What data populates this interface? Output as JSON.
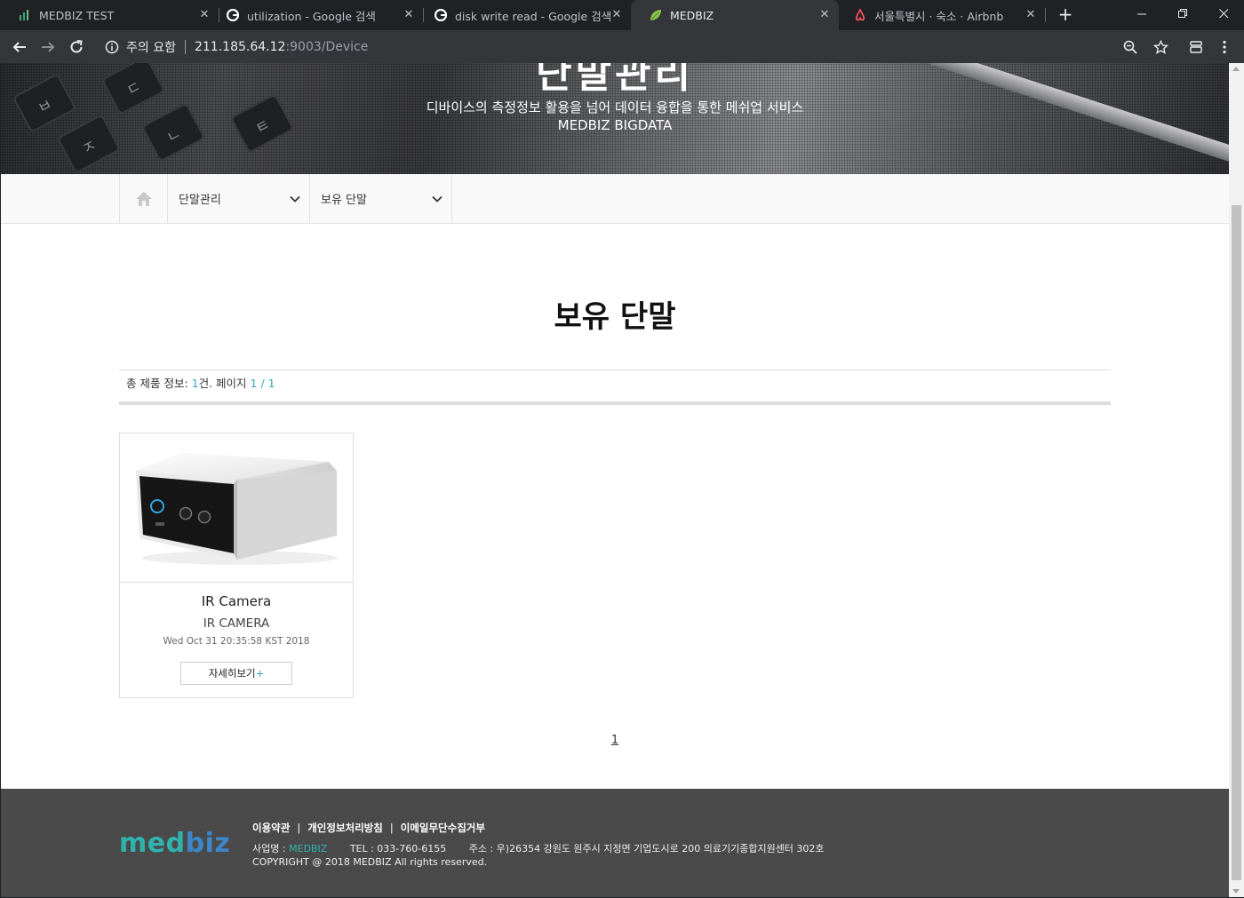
{
  "browser": {
    "tabs": [
      {
        "title": "MEDBIZ TEST",
        "favicon": "bar-chart-icon",
        "active": false
      },
      {
        "title": "utilization - Google 검색",
        "favicon": "google-icon",
        "active": false
      },
      {
        "title": "disk write read - Google 검색",
        "favicon": "google-icon",
        "active": false
      },
      {
        "title": "MEDBIZ",
        "favicon": "leaf-icon",
        "active": true
      },
      {
        "title": "서울특별시 · 숙소 · Airbnb",
        "favicon": "airbnb-icon",
        "active": false
      }
    ],
    "new_tab": "+",
    "security_warning": "주의 요함",
    "url_host": "211.185.64.12",
    "url_rest": ":9003/Device"
  },
  "hero": {
    "title": "단말관리",
    "subtitle": "디바이스의 측정정보 활용을 넘어 데이터 융합을 통한 메쉬업 서비스",
    "subtitle2": "MEDBIZ BIGDATA"
  },
  "subnav": {
    "menu1": "단말관리",
    "menu2": "보유 단말"
  },
  "page": {
    "title": "보유 단말",
    "summary_prefix": "총 제품 정보: ",
    "summary_count": "1",
    "summary_mid": "건. 페이지 ",
    "summary_pages": "1 / 1"
  },
  "devices": [
    {
      "name": "IR Camera",
      "model": "IR CAMERA",
      "date": "Wed Oct 31 20:35:58 KST 2018",
      "detail_label": "자세히보기",
      "detail_plus": "+"
    }
  ],
  "pagination": {
    "current": "1"
  },
  "footer": {
    "logo_a": "med",
    "logo_b": "biz",
    "link_terms": "이용약관",
    "link_privacy": "개인정보처리방침",
    "link_email": "이메일무단수집거부",
    "sep": "|",
    "company_label": "사업명 : ",
    "company_name": "MEDBIZ",
    "tel": "TEL : 033-760-6155",
    "address": "주소 : 우)26354 강원도 원주시 지정면 기업도시로 200 의료기기종합지원센터 302호",
    "copyright": "COPYRIGHT @ 2018 MEDBIZ All rights reserved."
  },
  "colors": {
    "accent": "#3aa6b9",
    "logo_green": "#2fb3ae",
    "logo_blue": "#3d86c7",
    "footer_bg": "#4a4a4a"
  }
}
